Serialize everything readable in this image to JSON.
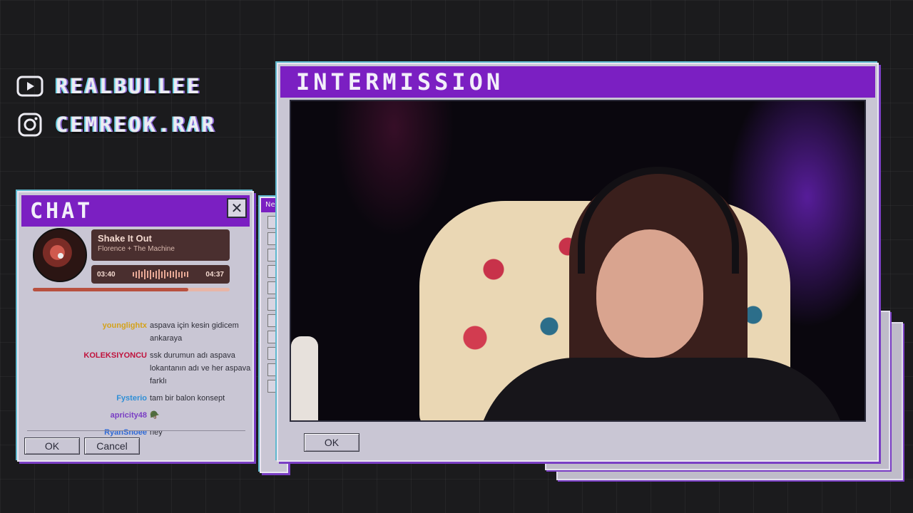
{
  "socials": [
    {
      "icon": "youtube-icon",
      "handle": "REALBULLEE"
    },
    {
      "icon": "instagram-icon",
      "handle": "CEMREOK.RAR"
    }
  ],
  "chat_window": {
    "title": "CHAT",
    "now_playing": {
      "title": "Shake It Out",
      "artist": "Florence + The Machine",
      "elapsed": "03:40",
      "duration": "04:37",
      "progress": 0.79
    },
    "messages": [
      {
        "user": "younglightx",
        "user_color": "#d4a21a",
        "text": "aspava için kesin gidicem ankaraya"
      },
      {
        "user": "KOLEKSIYONCU",
        "user_color": "#c0123c",
        "text": "ssk durumun adı aspava lokantanın adı ve her aspava farklı"
      },
      {
        "user": "Fysterio",
        "user_color": "#2f8fd6",
        "text": "tam bir balon konsept"
      },
      {
        "user": "apricity48",
        "user_color": "#7a3ec4",
        "text": "🪖"
      },
      {
        "user": "RyanSnoee",
        "user_color": "#2f6ad6",
        "text": "ney"
      }
    ],
    "ok_label": "OK",
    "cancel_label": "Cancel"
  },
  "tool_window": {
    "title": "Ne"
  },
  "main_window": {
    "title": "INTERMISSION",
    "ok_label": "OK"
  },
  "colors": {
    "title_bar": "#7b1fc2",
    "window_body": "#c9c6d4",
    "background": "#1b1b1d"
  }
}
